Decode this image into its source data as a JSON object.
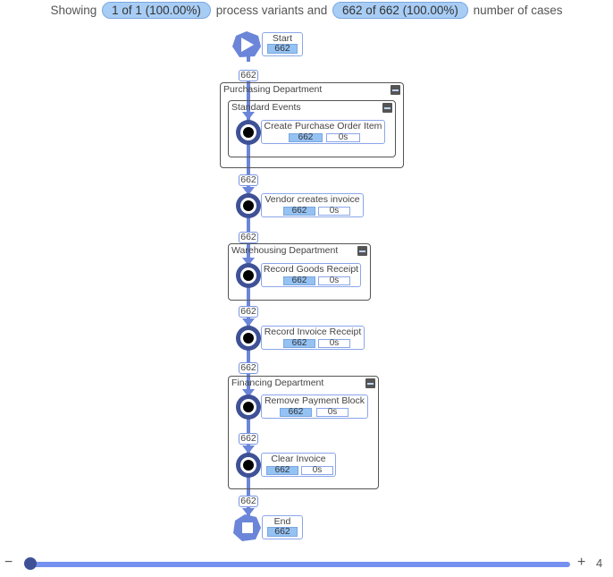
{
  "summary": {
    "prefix": "Showing",
    "variants_pill": "1 of 1 (100.00%)",
    "middle": "process variants and",
    "cases_pill": "662 of 662 (100.00%)",
    "suffix": "number of cases"
  },
  "start": {
    "label": "Start",
    "count": "662",
    "icon": "play-icon"
  },
  "end": {
    "label": "End",
    "count": "662",
    "icon": "stop-icon"
  },
  "edge_counts": [
    "662",
    "662",
    "662",
    "662",
    "662",
    "662",
    "662"
  ],
  "groups": {
    "purchasing": {
      "title": "Purchasing Department"
    },
    "standard": {
      "title": "Standard Events"
    },
    "warehousing": {
      "title": "Warehousing Department"
    },
    "financing": {
      "title": "Financing Department"
    }
  },
  "activities": [
    {
      "name": "Create Purchase Order Item",
      "count": "662",
      "duration": "0s"
    },
    {
      "name": "Vendor creates invoice",
      "count": "662",
      "duration": "0s"
    },
    {
      "name": "Record Goods Receipt",
      "count": "662",
      "duration": "0s"
    },
    {
      "name": "Record Invoice Receipt",
      "count": "662",
      "duration": "0s"
    },
    {
      "name": "Remove Payment Block",
      "count": "662",
      "duration": "0s"
    },
    {
      "name": "Clear Invoice",
      "count": "662",
      "duration": "0s"
    }
  ],
  "slider": {
    "minus_label": "−",
    "plus_label": "+",
    "value": "4",
    "position_fraction": 0.0
  },
  "colors": {
    "edge": "#6b85d8",
    "node": "#3f5196",
    "pill": "#a8cdf5",
    "count_fill": "#94c2f3"
  }
}
